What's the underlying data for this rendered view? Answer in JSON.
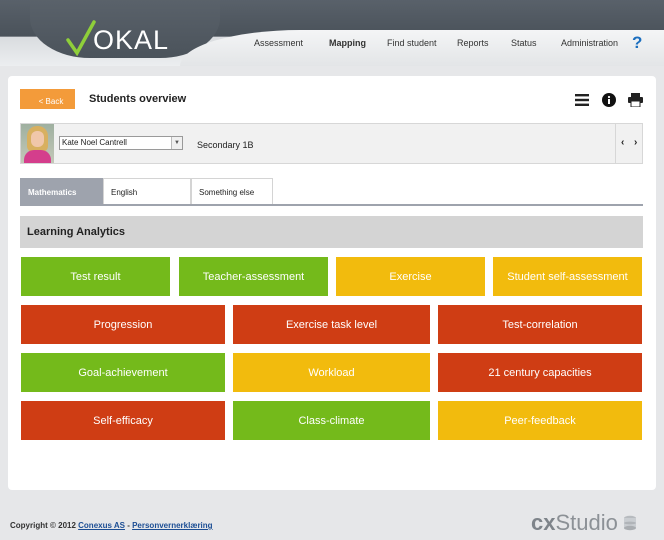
{
  "header": {
    "logo_text": "OKAL",
    "nav": [
      {
        "label": "Assessment",
        "active": false
      },
      {
        "label": "Mapping",
        "active": true
      },
      {
        "label": "Find student",
        "active": false
      },
      {
        "label": "Reports",
        "active": false
      },
      {
        "label": "Status",
        "active": false
      },
      {
        "label": "Administration",
        "active": false
      }
    ],
    "help_label": "?"
  },
  "toolbar": {
    "back_label": "< Back",
    "title": "Students overview",
    "icons": [
      "menu-icon",
      "info-icon",
      "print-icon"
    ]
  },
  "student": {
    "name": "Kate Noel Cantrell",
    "class": "Secondary 1B",
    "prev_label": "‹",
    "next_label": "›"
  },
  "tabs": [
    {
      "label": "Mathematics",
      "active": true
    },
    {
      "label": "English",
      "active": false
    },
    {
      "label": "Something else",
      "active": false
    }
  ],
  "section": {
    "title": "Learning Analytics",
    "tiles": [
      {
        "label": "Test result",
        "status": "green"
      },
      {
        "label": "Teacher-assessment",
        "status": "green"
      },
      {
        "label": "Exercise",
        "status": "yellow"
      },
      {
        "label": "Student self-assessment",
        "status": "yellow"
      },
      {
        "label": "Progression",
        "status": "red"
      },
      {
        "label": "Exercise task level",
        "status": "red"
      },
      {
        "label": "Test-correlation",
        "status": "red"
      },
      {
        "label": "Goal-achievement",
        "status": "green"
      },
      {
        "label": "Workload",
        "status": "yellow"
      },
      {
        "label": "21 century capacities",
        "status": "red"
      },
      {
        "label": "Self-efficacy",
        "status": "red"
      },
      {
        "label": "Class-climate",
        "status": "green"
      },
      {
        "label": "Peer-feedback",
        "status": "yellow"
      }
    ]
  },
  "colors": {
    "green": "#74ba1b",
    "yellow": "#f2bb0d",
    "red": "#cf3d14",
    "accent": "#f39b3a"
  },
  "footer": {
    "copyright": "Copyright © 2012 ",
    "company": "Conexus AS",
    "separator": " - ",
    "privacy": "Personvernerklæring",
    "brand_cx": "cx",
    "brand_studio": "Studio"
  }
}
